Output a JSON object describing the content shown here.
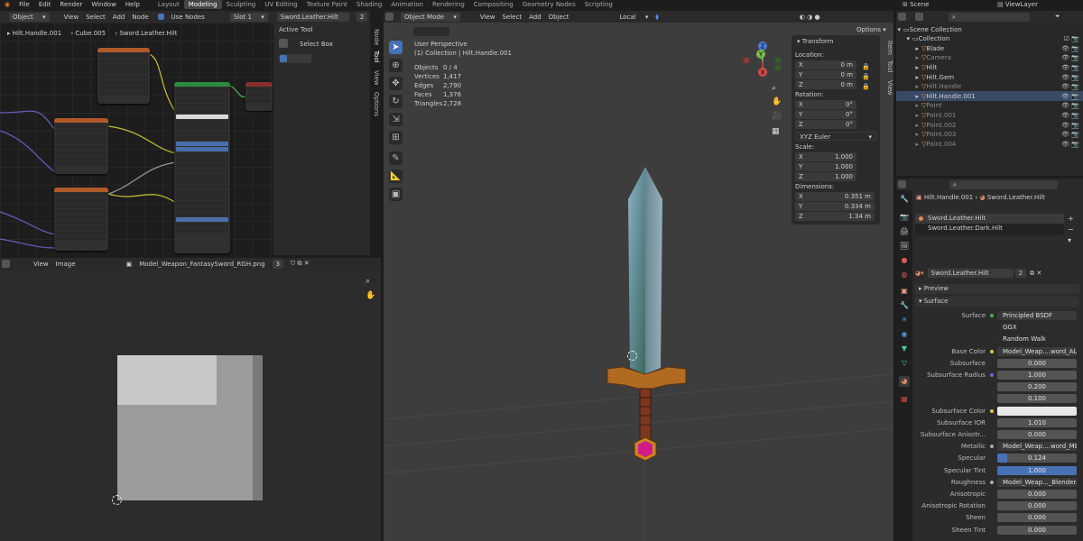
{
  "topbar": {
    "menus": [
      "File",
      "Edit",
      "Render",
      "Window",
      "Help"
    ],
    "workspaces": [
      "Layout",
      "Modeling",
      "Sculpting",
      "UV Editing",
      "Texture Paint",
      "Shading",
      "Animation",
      "Rendering",
      "Compositing",
      "Geometry Nodes",
      "Scripting"
    ],
    "active_workspace": "Modeling",
    "scene": "Scene",
    "view_layer": "ViewLayer"
  },
  "node_editor": {
    "mode": "Object",
    "menus": [
      "View",
      "Select",
      "Add",
      "Node"
    ],
    "use_nodes": "Use Nodes",
    "slot": "Slot 1",
    "material": "Sword.Leather.Hilt",
    "material_users": "2",
    "breadcrumb": [
      "Hilt.Handle.001",
      "Cube.005",
      "Sword.Leather.Hilt"
    ],
    "tabs": [
      "Node",
      "Tool",
      "View",
      "Options"
    ],
    "active_tool_title": "Active Tool",
    "active_tool_name": "Select Box"
  },
  "image_editor": {
    "menus": [
      "View",
      "Image"
    ],
    "image_name": "Model_Weapon_FantasySword_RGH.png",
    "image_users": "3"
  },
  "viewport": {
    "mode": "Object Mode",
    "menus": [
      "View",
      "Select",
      "Add",
      "Object"
    ],
    "orientation": "Local",
    "options_label": "Options",
    "title": "User Perspective",
    "subtitle": "(1) Collection | Hilt.Handle.001",
    "stats": [
      {
        "label": "Objects",
        "value": "0 / 4"
      },
      {
        "label": "Vertices",
        "value": "1,417"
      },
      {
        "label": "Edges",
        "value": "2,790"
      },
      {
        "label": "Faces",
        "value": "1,376"
      },
      {
        "label": "Triangles",
        "value": "2,728"
      }
    ],
    "side_tabs": [
      "Item",
      "Tool",
      "View"
    ],
    "transform": {
      "title": "Transform",
      "location_label": "Location:",
      "location": [
        {
          "axis": "X",
          "value": "0 m"
        },
        {
          "axis": "Y",
          "value": "0 m"
        },
        {
          "axis": "Z",
          "value": "0 m"
        }
      ],
      "rotation_label": "Rotation:",
      "rotation": [
        {
          "axis": "X",
          "value": "0°"
        },
        {
          "axis": "Y",
          "value": "0°"
        },
        {
          "axis": "Z",
          "value": "0°"
        }
      ],
      "rotation_mode": "XYZ Euler",
      "scale_label": "Scale:",
      "scale": [
        {
          "axis": "X",
          "value": "1.000"
        },
        {
          "axis": "Y",
          "value": "1.000"
        },
        {
          "axis": "Z",
          "value": "1.000"
        }
      ],
      "dimensions_label": "Dimensions:",
      "dimensions": [
        {
          "axis": "X",
          "value": "0.351 m"
        },
        {
          "axis": "Y",
          "value": "0.334 m"
        },
        {
          "axis": "Z",
          "value": "1.34 m"
        }
      ]
    },
    "gizmo_axes": [
      "Z",
      "Y",
      "X"
    ]
  },
  "outliner": {
    "items": [
      {
        "name": "Scene Collection",
        "level": 0,
        "dim": false
      },
      {
        "name": "Collection",
        "level": 1,
        "dim": false
      },
      {
        "name": "Blade",
        "level": 2,
        "dim": false
      },
      {
        "name": "Camera",
        "level": 2,
        "dim": true
      },
      {
        "name": "Hilt",
        "level": 2,
        "dim": false
      },
      {
        "name": "Hilt.Gem",
        "level": 2,
        "dim": false
      },
      {
        "name": "Hilt.Handle",
        "level": 2,
        "dim": true
      },
      {
        "name": "Hilt.Handle.001",
        "level": 2,
        "dim": false,
        "selected": true
      },
      {
        "name": "Point",
        "level": 2,
        "dim": true
      },
      {
        "name": "Point.001",
        "level": 2,
        "dim": true
      },
      {
        "name": "Point.002",
        "level": 2,
        "dim": true
      },
      {
        "name": "Point.003",
        "level": 2,
        "dim": true
      },
      {
        "name": "Point.004",
        "level": 2,
        "dim": true
      }
    ]
  },
  "properties": {
    "breadcrumb": [
      "Hilt.Handle.001",
      "Sword.Leather.Hilt"
    ],
    "material_slots": [
      "Sword.Leather.Hilt",
      "Sword.Leather.Dark.Hilt"
    ],
    "material_name": "Sword.Leather.Hilt",
    "material_users": "2",
    "preview_label": "Preview",
    "surface_label": "Surface",
    "rows": [
      {
        "label": "Surface",
        "value": "Principled BSDF",
        "kind": "tex",
        "dot": "#4caf50"
      },
      {
        "label": "",
        "value": "GGX",
        "kind": "drop"
      },
      {
        "label": "",
        "value": "Random Walk",
        "kind": "drop"
      },
      {
        "label": "Base Color",
        "value": "Model_Weap....word_ALB.png",
        "kind": "tex",
        "dot": "#e8c24a"
      },
      {
        "label": "Subsurface",
        "value": "0.000",
        "kind": "num"
      },
      {
        "label": "Subsurface Radius",
        "value": "1.000",
        "kind": "num",
        "dot": "#6a6ae8"
      },
      {
        "label": "",
        "value": "0.200",
        "kind": "num"
      },
      {
        "label": "",
        "value": "0.100",
        "kind": "num"
      },
      {
        "label": "Subsurface Color",
        "value": "",
        "kind": "white",
        "dot": "#e8c24a"
      },
      {
        "label": "Subsurface IOR",
        "value": "1.010",
        "kind": "num"
      },
      {
        "label": "Subsurface Anisotr...",
        "value": "0.000",
        "kind": "num"
      },
      {
        "label": "Metallic",
        "value": "Model_Weap....word_MET.png",
        "kind": "tex",
        "dot": "#aaaaaa"
      },
      {
        "label": "Specular",
        "value": "0.124",
        "kind": "num",
        "fill": 0.124
      },
      {
        "label": "Specular Tint",
        "value": "1.000",
        "kind": "num",
        "fill": 1.0
      },
      {
        "label": "Roughness",
        "value": "Model_Weap..._Blender.png",
        "kind": "tex",
        "dot": "#aaaaaa"
      },
      {
        "label": "Anisotropic",
        "value": "0.000",
        "kind": "num"
      },
      {
        "label": "Anisotropic Rotation",
        "value": "0.000",
        "kind": "num"
      },
      {
        "label": "Sheen",
        "value": "0.000",
        "kind": "num"
      },
      {
        "label": "Sheen Tint",
        "value": "0.000",
        "kind": "num"
      }
    ]
  }
}
